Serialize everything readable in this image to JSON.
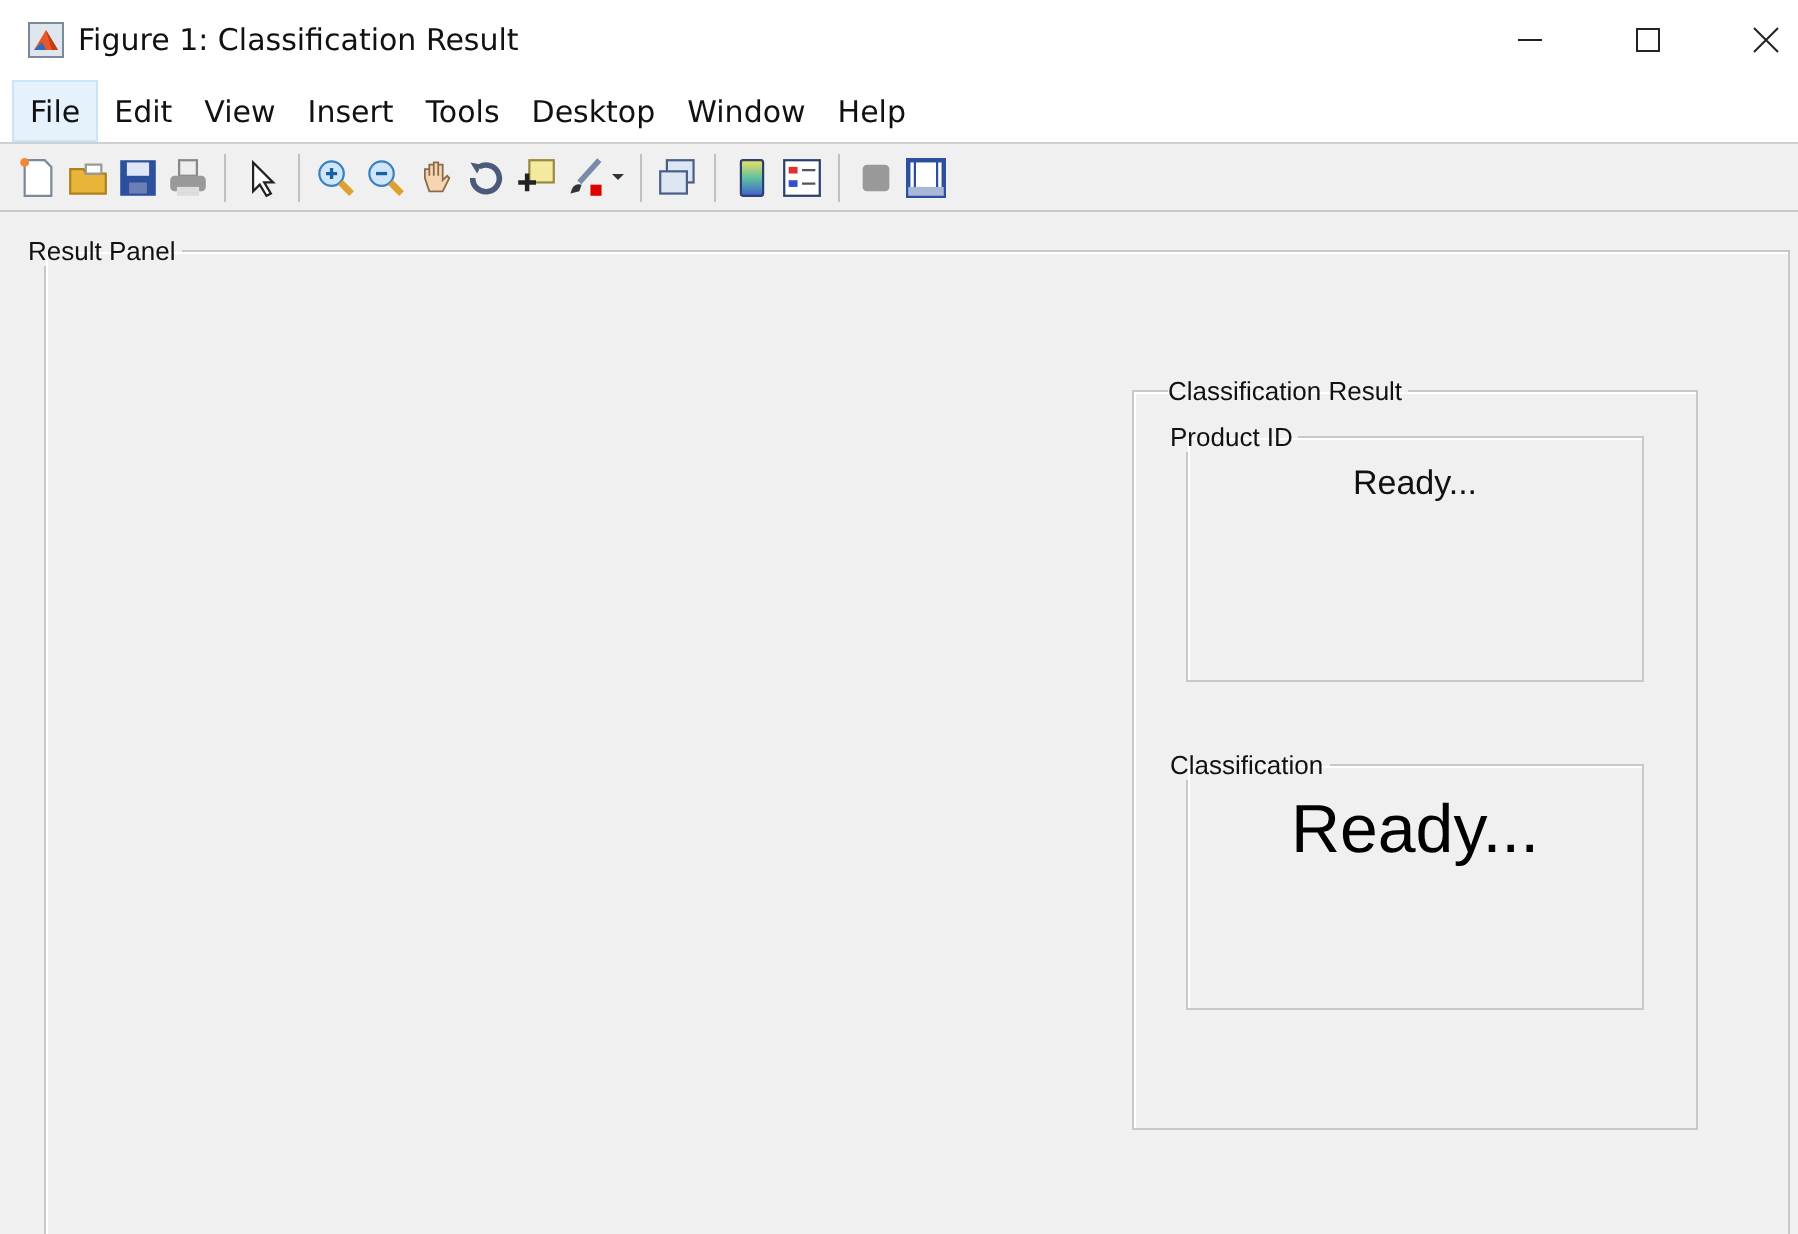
{
  "window": {
    "title": "Figure 1: Classification Result"
  },
  "menu": [
    {
      "label": "File",
      "selected": true
    },
    {
      "label": "Edit",
      "selected": false
    },
    {
      "label": "View",
      "selected": false
    },
    {
      "label": "Insert",
      "selected": false
    },
    {
      "label": "Tools",
      "selected": false
    },
    {
      "label": "Desktop",
      "selected": false
    },
    {
      "label": "Window",
      "selected": false
    },
    {
      "label": "Help",
      "selected": false
    }
  ],
  "result_panel": {
    "title": "Result Panel",
    "classification_result": {
      "title": "Classification Result",
      "boxes": [
        {
          "title": "Product ID",
          "text": "Ready...",
          "kind": "small"
        },
        {
          "title": "Classification",
          "text": "Ready...",
          "kind": "large"
        }
      ]
    }
  }
}
